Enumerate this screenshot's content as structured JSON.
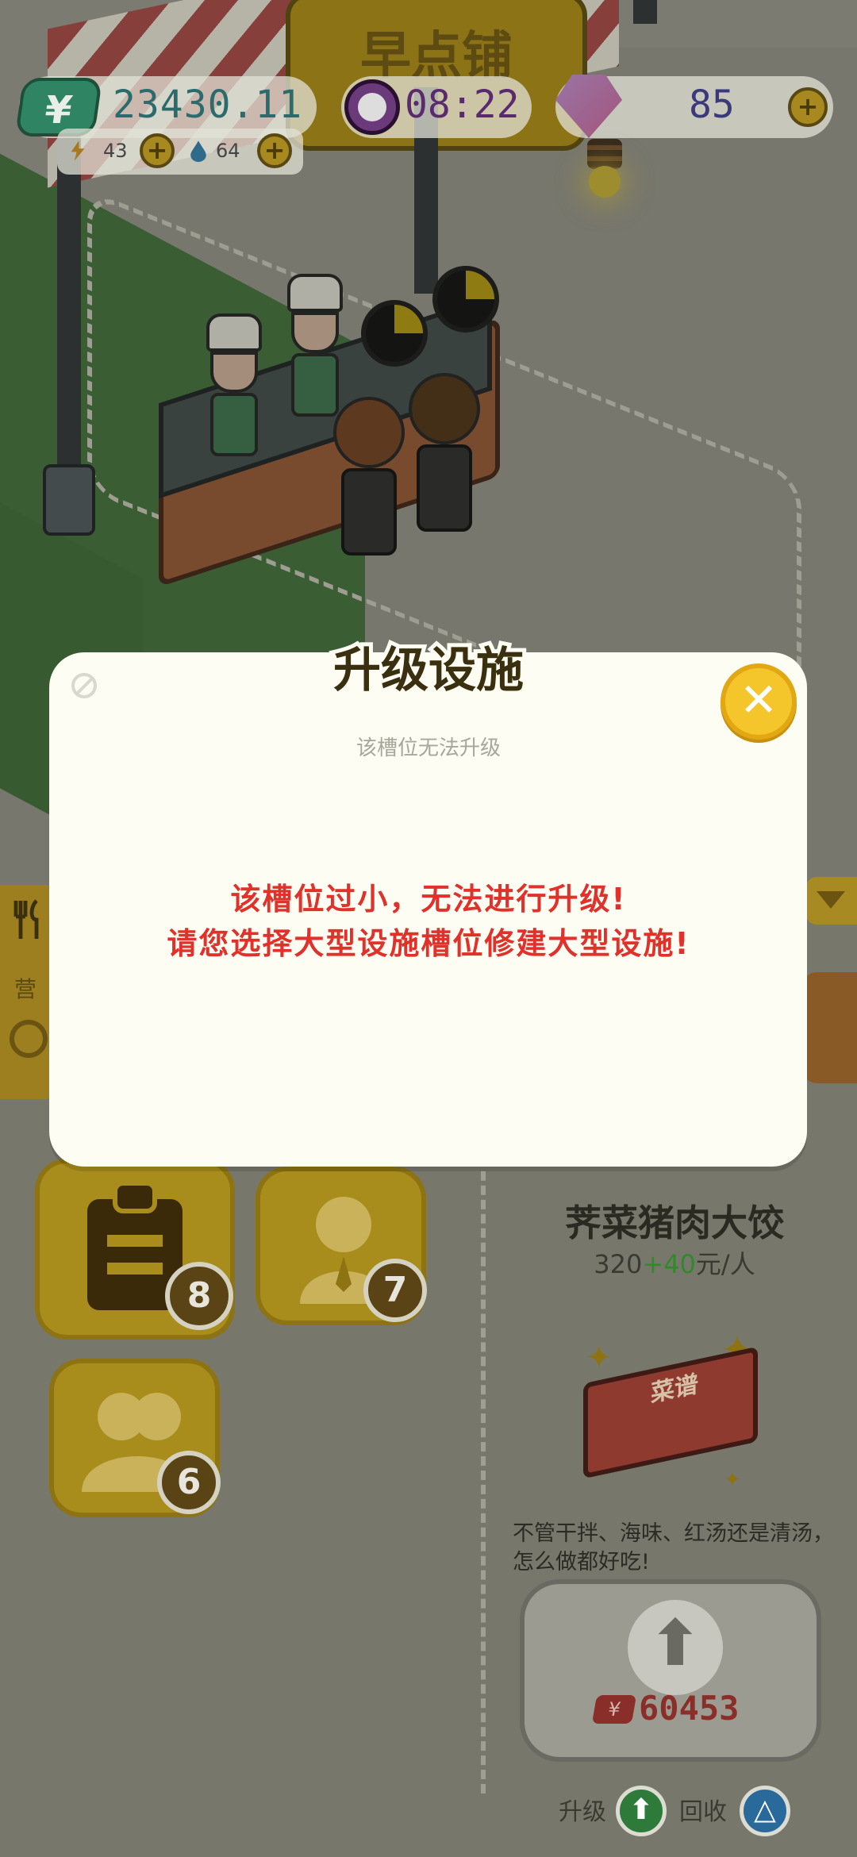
{
  "hud": {
    "money": "23430.11",
    "money_symbol": "¥",
    "energy": "43",
    "water": "64",
    "clock": "08:22",
    "gems": "85",
    "plus": "+"
  },
  "scene": {
    "sign_text": "早点铺"
  },
  "modal": {
    "title": "升级设施",
    "subtitle": "该槽位无法升级",
    "message_line1": "该槽位过小，无法进行升级!",
    "message_line2": "请您选择大型设施槽位修建大型设施!",
    "close_symbol": "✕"
  },
  "side_panel": {
    "tab_label": "营"
  },
  "tiles": {
    "orders_count": "8",
    "staff_count": "7",
    "customers_count": "6"
  },
  "dish": {
    "name": "荠菜猪肉大饺",
    "price_base": "320",
    "price_bonus": "+40",
    "price_unit": "元/人",
    "book_label": "菜谱",
    "description": "不管干拌、海味、红汤还是清汤，怎么做都好吃!",
    "upgrade_cost": "60453",
    "cost_symbol": "¥"
  },
  "bottom": {
    "upgrade_label": "升级",
    "recycle_label": "回收"
  },
  "colors": {
    "message_red": "#e0312b",
    "close_yellow": "#f5c62c",
    "bonus_green": "#2f8a2a"
  }
}
